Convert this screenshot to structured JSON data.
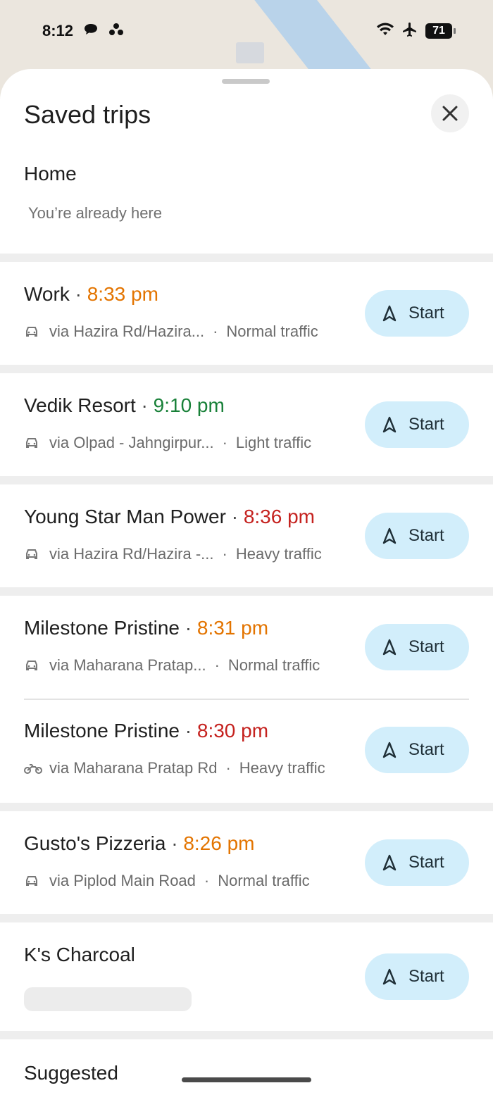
{
  "status_bar": {
    "time": "8:12",
    "battery": "71"
  },
  "sheet": {
    "title": "Saved trips",
    "home": {
      "label": "Home",
      "subtitle": "You’re already here"
    },
    "start_label": "Start",
    "trips": [
      {
        "name": "Work",
        "time": "8:33 pm",
        "time_color": "#e37400",
        "mode": "car",
        "via": "via Hazira Rd/Hazira...",
        "traffic": "Normal traffic"
      },
      {
        "name": "Vedik Resort",
        "time": "9:10 pm",
        "time_color": "#188038",
        "mode": "car",
        "via": "via Olpad - Jahngirpur...",
        "traffic": "Light traffic"
      },
      {
        "name": "Young Star Man Power",
        "time": "8:36 pm",
        "time_color": "#c5221f",
        "mode": "car",
        "via": "via Hazira Rd/Hazira -...",
        "traffic": "Heavy traffic"
      },
      {
        "name": "Milestone Pristine",
        "time": "8:31 pm",
        "time_color": "#e37400",
        "mode": "car",
        "via": "via Maharana Pratap...",
        "traffic": "Normal traffic"
      },
      {
        "name": "Milestone Pristine",
        "time": "8:30 pm",
        "time_color": "#c5221f",
        "mode": "bike",
        "via": "via Maharana Pratap Rd",
        "traffic": "Heavy traffic"
      },
      {
        "name": "Gusto's Pizzeria",
        "time": "8:26 pm",
        "time_color": "#e37400",
        "mode": "car",
        "via": "via Piplod Main Road",
        "traffic": "Normal traffic"
      },
      {
        "name": "K's Charcoal",
        "time": "",
        "time_color": "",
        "mode": "",
        "via": "",
        "traffic": ""
      }
    ],
    "suggested_label": "Suggested"
  },
  "colors": {
    "start_bg": "#d2eefb",
    "sheet_bg": "#ffffff",
    "separator": "#eeeeee"
  }
}
